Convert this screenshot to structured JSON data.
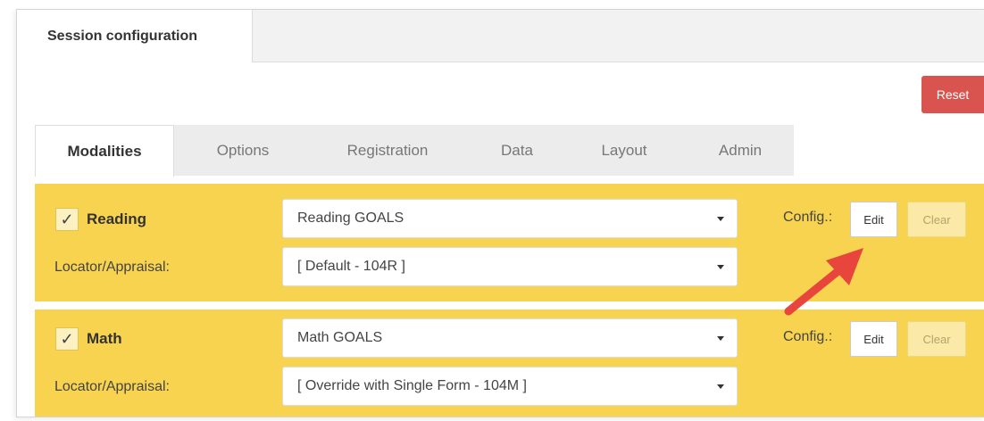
{
  "top_tab": {
    "label": "Session configuration"
  },
  "reset_label": "Reset",
  "tabs": [
    {
      "label": "Modalities",
      "active": true
    },
    {
      "label": "Options"
    },
    {
      "label": "Registration"
    },
    {
      "label": "Data"
    },
    {
      "label": "Layout"
    },
    {
      "label": "Admin"
    }
  ],
  "modalities": [
    {
      "name": "Reading",
      "checked": true,
      "goals_value": "Reading GOALS",
      "locator_label": "Locator/Appraisal:",
      "locator_value": "[ Default - 104R ]",
      "config_label": "Config.:",
      "edit_label": "Edit",
      "clear_label": "Clear"
    },
    {
      "name": "Math",
      "checked": true,
      "goals_value": "Math GOALS",
      "locator_label": "Locator/Appraisal:",
      "locator_value": "[ Override with Single Form - 104M ]",
      "config_label": "Config.:",
      "edit_label": "Edit",
      "clear_label": "Clear"
    }
  ],
  "colors": {
    "panel": "#f8d34f",
    "reset": "#d9534f",
    "arrow": "#e8453c"
  },
  "icons": {
    "checkbox": "checkmark-icon",
    "dropdown": "caret-down-icon",
    "annotation": "red-arrow-icon"
  }
}
